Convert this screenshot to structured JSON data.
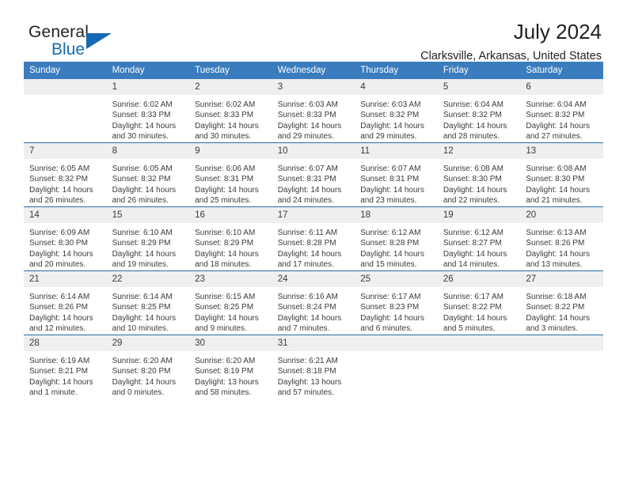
{
  "brand": {
    "name_part1": "General",
    "name_part2": "Blue",
    "logo_icon": "triangle-logo-icon",
    "accent_color": "#1569b4"
  },
  "header": {
    "title": "July 2024",
    "subtitle": "Clarksville, Arkansas, United States"
  },
  "calendar": {
    "header_bg": "#3a7cbe",
    "daynum_bg": "#efefef",
    "weekdays": [
      "Sunday",
      "Monday",
      "Tuesday",
      "Wednesday",
      "Thursday",
      "Friday",
      "Saturday"
    ],
    "weeks": [
      [
        {
          "day": "",
          "lines": []
        },
        {
          "day": "1",
          "lines": [
            "Sunrise: 6:02 AM",
            "Sunset: 8:33 PM",
            "Daylight: 14 hours",
            "and 30 minutes."
          ]
        },
        {
          "day": "2",
          "lines": [
            "Sunrise: 6:02 AM",
            "Sunset: 8:33 PM",
            "Daylight: 14 hours",
            "and 30 minutes."
          ]
        },
        {
          "day": "3",
          "lines": [
            "Sunrise: 6:03 AM",
            "Sunset: 8:33 PM",
            "Daylight: 14 hours",
            "and 29 minutes."
          ]
        },
        {
          "day": "4",
          "lines": [
            "Sunrise: 6:03 AM",
            "Sunset: 8:32 PM",
            "Daylight: 14 hours",
            "and 29 minutes."
          ]
        },
        {
          "day": "5",
          "lines": [
            "Sunrise: 6:04 AM",
            "Sunset: 8:32 PM",
            "Daylight: 14 hours",
            "and 28 minutes."
          ]
        },
        {
          "day": "6",
          "lines": [
            "Sunrise: 6:04 AM",
            "Sunset: 8:32 PM",
            "Daylight: 14 hours",
            "and 27 minutes."
          ]
        }
      ],
      [
        {
          "day": "7",
          "lines": [
            "Sunrise: 6:05 AM",
            "Sunset: 8:32 PM",
            "Daylight: 14 hours",
            "and 26 minutes."
          ]
        },
        {
          "day": "8",
          "lines": [
            "Sunrise: 6:05 AM",
            "Sunset: 8:32 PM",
            "Daylight: 14 hours",
            "and 26 minutes."
          ]
        },
        {
          "day": "9",
          "lines": [
            "Sunrise: 6:06 AM",
            "Sunset: 8:31 PM",
            "Daylight: 14 hours",
            "and 25 minutes."
          ]
        },
        {
          "day": "10",
          "lines": [
            "Sunrise: 6:07 AM",
            "Sunset: 8:31 PM",
            "Daylight: 14 hours",
            "and 24 minutes."
          ]
        },
        {
          "day": "11",
          "lines": [
            "Sunrise: 6:07 AM",
            "Sunset: 8:31 PM",
            "Daylight: 14 hours",
            "and 23 minutes."
          ]
        },
        {
          "day": "12",
          "lines": [
            "Sunrise: 6:08 AM",
            "Sunset: 8:30 PM",
            "Daylight: 14 hours",
            "and 22 minutes."
          ]
        },
        {
          "day": "13",
          "lines": [
            "Sunrise: 6:08 AM",
            "Sunset: 8:30 PM",
            "Daylight: 14 hours",
            "and 21 minutes."
          ]
        }
      ],
      [
        {
          "day": "14",
          "lines": [
            "Sunrise: 6:09 AM",
            "Sunset: 8:30 PM",
            "Daylight: 14 hours",
            "and 20 minutes."
          ]
        },
        {
          "day": "15",
          "lines": [
            "Sunrise: 6:10 AM",
            "Sunset: 8:29 PM",
            "Daylight: 14 hours",
            "and 19 minutes."
          ]
        },
        {
          "day": "16",
          "lines": [
            "Sunrise: 6:10 AM",
            "Sunset: 8:29 PM",
            "Daylight: 14 hours",
            "and 18 minutes."
          ]
        },
        {
          "day": "17",
          "lines": [
            "Sunrise: 6:11 AM",
            "Sunset: 8:28 PM",
            "Daylight: 14 hours",
            "and 17 minutes."
          ]
        },
        {
          "day": "18",
          "lines": [
            "Sunrise: 6:12 AM",
            "Sunset: 8:28 PM",
            "Daylight: 14 hours",
            "and 15 minutes."
          ]
        },
        {
          "day": "19",
          "lines": [
            "Sunrise: 6:12 AM",
            "Sunset: 8:27 PM",
            "Daylight: 14 hours",
            "and 14 minutes."
          ]
        },
        {
          "day": "20",
          "lines": [
            "Sunrise: 6:13 AM",
            "Sunset: 8:26 PM",
            "Daylight: 14 hours",
            "and 13 minutes."
          ]
        }
      ],
      [
        {
          "day": "21",
          "lines": [
            "Sunrise: 6:14 AM",
            "Sunset: 8:26 PM",
            "Daylight: 14 hours",
            "and 12 minutes."
          ]
        },
        {
          "day": "22",
          "lines": [
            "Sunrise: 6:14 AM",
            "Sunset: 8:25 PM",
            "Daylight: 14 hours",
            "and 10 minutes."
          ]
        },
        {
          "day": "23",
          "lines": [
            "Sunrise: 6:15 AM",
            "Sunset: 8:25 PM",
            "Daylight: 14 hours",
            "and 9 minutes."
          ]
        },
        {
          "day": "24",
          "lines": [
            "Sunrise: 6:16 AM",
            "Sunset: 8:24 PM",
            "Daylight: 14 hours",
            "and 7 minutes."
          ]
        },
        {
          "day": "25",
          "lines": [
            "Sunrise: 6:17 AM",
            "Sunset: 8:23 PM",
            "Daylight: 14 hours",
            "and 6 minutes."
          ]
        },
        {
          "day": "26",
          "lines": [
            "Sunrise: 6:17 AM",
            "Sunset: 8:22 PM",
            "Daylight: 14 hours",
            "and 5 minutes."
          ]
        },
        {
          "day": "27",
          "lines": [
            "Sunrise: 6:18 AM",
            "Sunset: 8:22 PM",
            "Daylight: 14 hours",
            "and 3 minutes."
          ]
        }
      ],
      [
        {
          "day": "28",
          "lines": [
            "Sunrise: 6:19 AM",
            "Sunset: 8:21 PM",
            "Daylight: 14 hours",
            "and 1 minute."
          ]
        },
        {
          "day": "29",
          "lines": [
            "Sunrise: 6:20 AM",
            "Sunset: 8:20 PM",
            "Daylight: 14 hours",
            "and 0 minutes."
          ]
        },
        {
          "day": "30",
          "lines": [
            "Sunrise: 6:20 AM",
            "Sunset: 8:19 PM",
            "Daylight: 13 hours",
            "and 58 minutes."
          ]
        },
        {
          "day": "31",
          "lines": [
            "Sunrise: 6:21 AM",
            "Sunset: 8:18 PM",
            "Daylight: 13 hours",
            "and 57 minutes."
          ]
        },
        {
          "day": "",
          "lines": []
        },
        {
          "day": "",
          "lines": []
        },
        {
          "day": "",
          "lines": []
        }
      ]
    ]
  }
}
